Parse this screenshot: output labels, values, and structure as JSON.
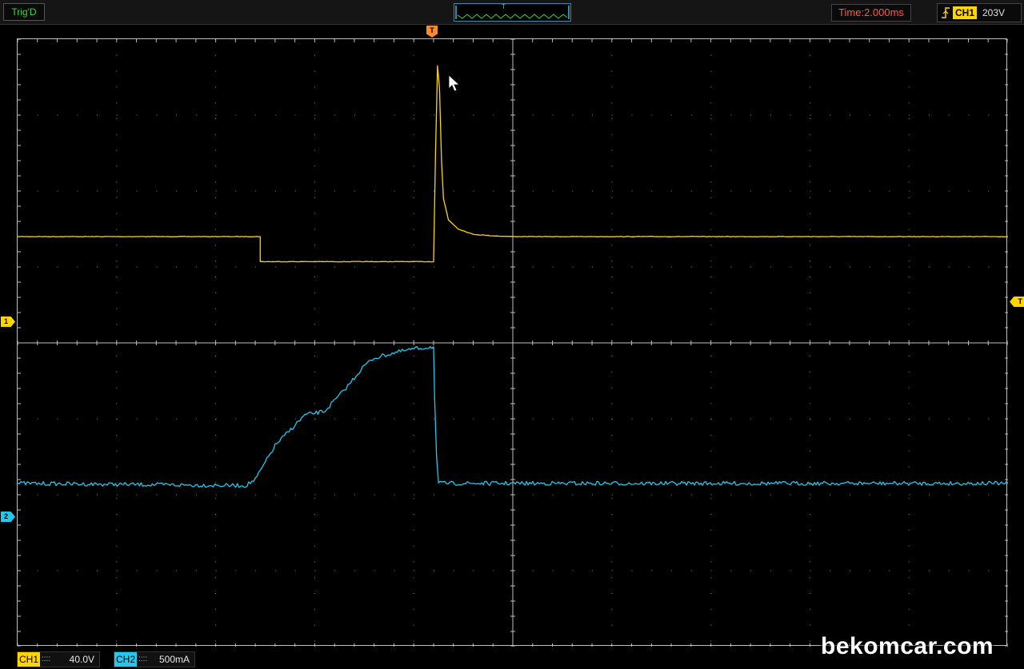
{
  "header": {
    "trigger_status": "Trig'D",
    "overview_marker": "T",
    "timebase": "Time:2.000ms",
    "trigger_channel": "CH1",
    "trigger_level": "203V",
    "trigger_edge_icon": "rising-edge-icon"
  },
  "markers": {
    "trigger_position": "T",
    "trigger_level": "T",
    "ch1": "1",
    "ch2": "2"
  },
  "channels": [
    {
      "id": "CH1",
      "coupling": "::::",
      "scale": "40.0V",
      "color": "#ffd500"
    },
    {
      "id": "CH2",
      "coupling": "::::",
      "scale": "500mA",
      "color": "#22c8ee"
    }
  ],
  "screen": {
    "divisions": {
      "x": 10,
      "y": 8
    },
    "grid_color": "#8a8a8a",
    "background": "#000000"
  },
  "chart_data": {
    "type": "line",
    "x_unit": "div",
    "y_unit": "div",
    "xlim": [
      0,
      10
    ],
    "ylim": [
      -4,
      4
    ],
    "grid": true,
    "series": [
      {
        "name": "CH1",
        "color": "#ffd500",
        "points": [
          [
            0,
            1.4
          ],
          [
            2.45,
            1.4
          ],
          [
            2.45,
            1.07
          ],
          [
            4.2,
            1.07
          ],
          [
            4.2,
            1.07
          ],
          [
            4.22,
            2.5
          ],
          [
            4.24,
            3.65
          ],
          [
            4.26,
            3.35
          ],
          [
            4.28,
            2.4
          ],
          [
            4.3,
            1.9
          ],
          [
            4.35,
            1.62
          ],
          [
            4.45,
            1.5
          ],
          [
            4.6,
            1.43
          ],
          [
            4.8,
            1.41
          ],
          [
            5.0,
            1.4
          ],
          [
            10,
            1.4
          ]
        ]
      },
      {
        "name": "CH2",
        "color": "#22c8ee",
        "points": [
          [
            0,
            -1.85
          ],
          [
            2.3,
            -1.88
          ],
          [
            2.4,
            -1.8
          ],
          [
            2.6,
            -1.35
          ],
          [
            2.9,
            -0.95
          ],
          [
            3.1,
            -0.9
          ],
          [
            3.3,
            -0.62
          ],
          [
            3.5,
            -0.3
          ],
          [
            3.6,
            -0.2
          ],
          [
            3.8,
            -0.13
          ],
          [
            4.0,
            -0.08
          ],
          [
            4.2,
            -0.05
          ],
          [
            4.21,
            -0.7
          ],
          [
            4.23,
            -1.5
          ],
          [
            4.25,
            -1.85
          ],
          [
            10,
            -1.85
          ]
        ]
      }
    ]
  },
  "watermark": "bekomcar.com"
}
